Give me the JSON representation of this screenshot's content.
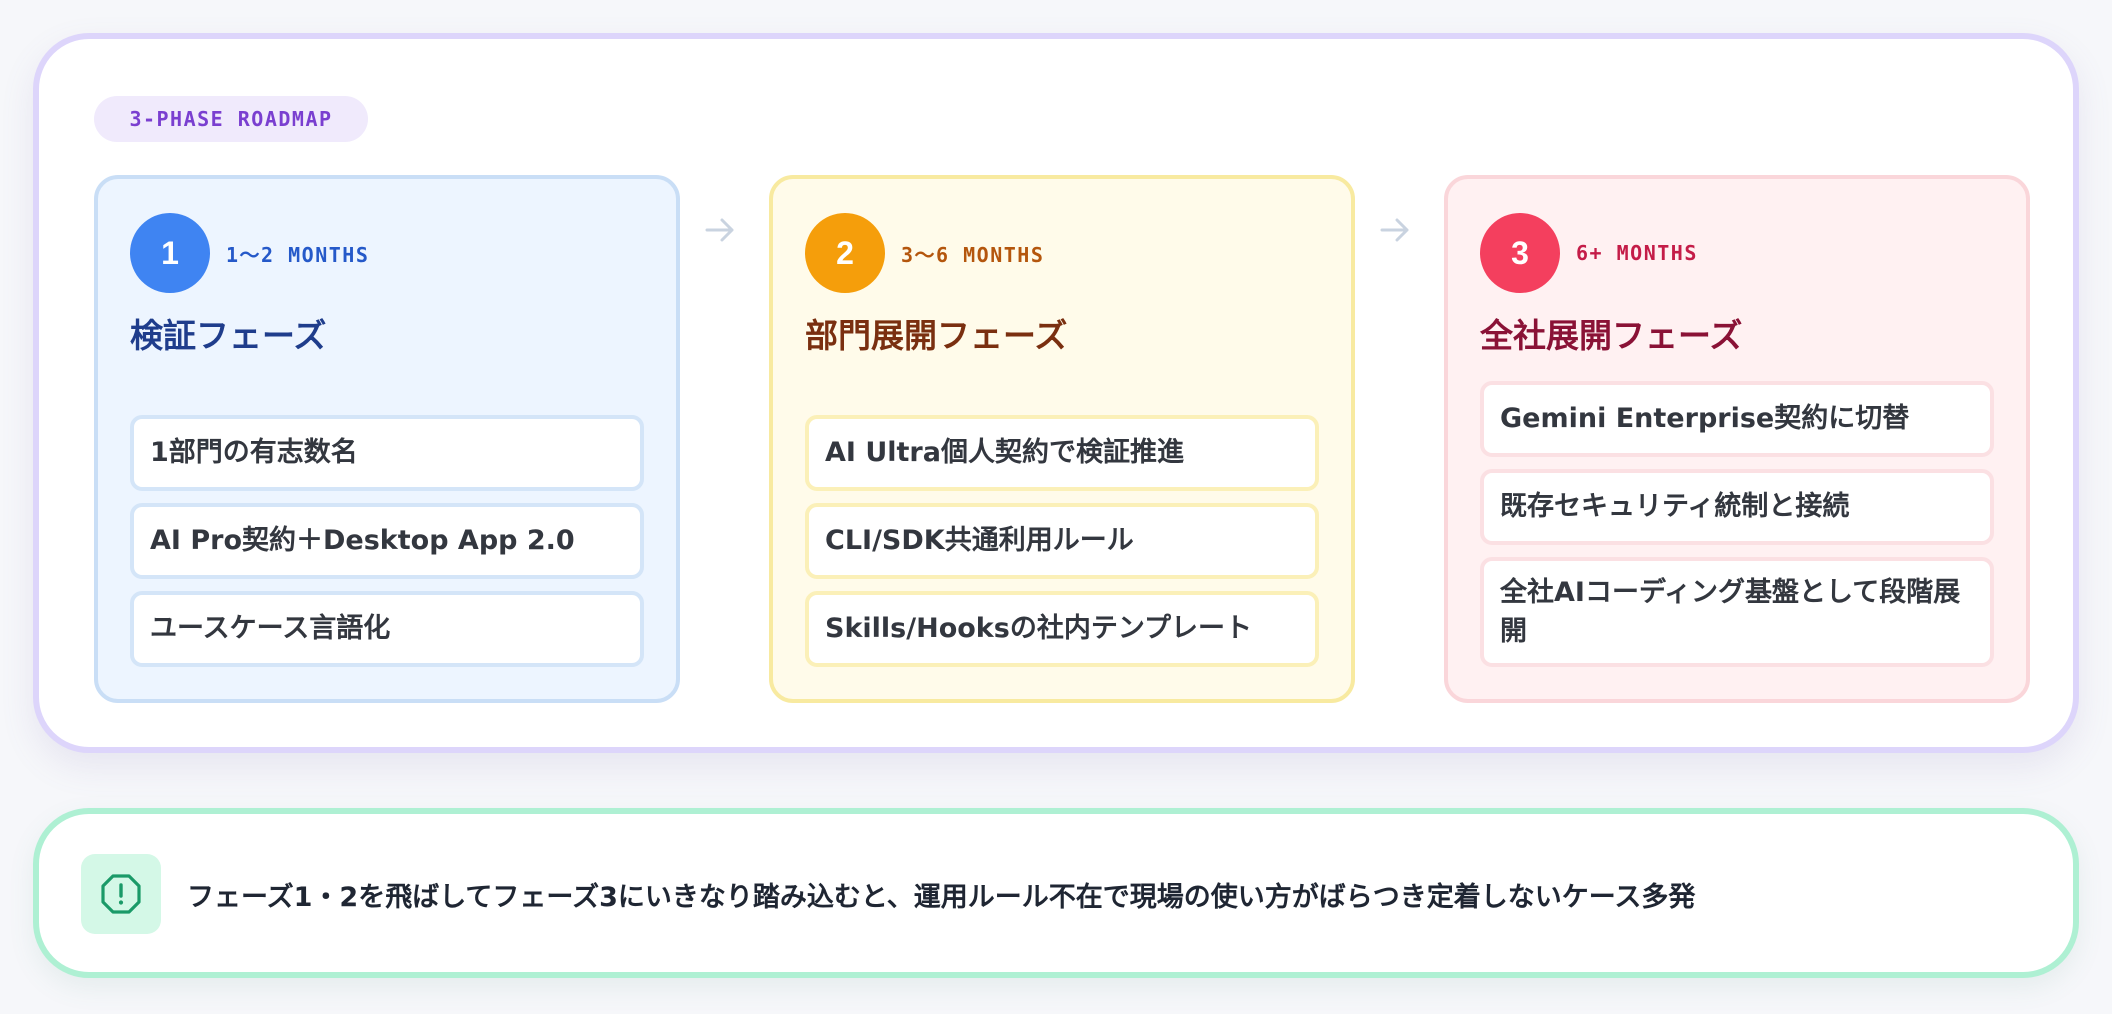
{
  "badge": "3-PHASE ROADMAP",
  "phases": [
    {
      "number": "1",
      "duration": "1〜2 MONTHS",
      "title": "検証フェーズ",
      "items": [
        "1部門の有志数名",
        "AI Pro契約＋Desktop App 2.0",
        "ユースケース言語化"
      ]
    },
    {
      "number": "2",
      "duration": "3〜6 MONTHS",
      "title": "部門展開フェーズ",
      "items": [
        "AI Ultra個人契約で検証推進",
        "CLI/SDK共通利用ルール",
        "Skills/Hooksの社内テンプレート"
      ]
    },
    {
      "number": "3",
      "duration": "6+ MONTHS",
      "title": "全社展開フェーズ",
      "items": [
        "Gemini Enterprise契約に切替",
        "既存セキュリティ統制と接続",
        "全社AIコーディング基盤として段階展開"
      ]
    }
  ],
  "warning": {
    "icon": "alert-circle-icon",
    "text": "フェーズ1・2を飛ばしてフェーズ3にいきなり踏み込むと、運用ルール不在で現場の使い方がばらつき定着しないケース多発"
  },
  "colors": {
    "phase1_accent": "#3f84f2",
    "phase2_accent": "#f59e0b",
    "phase3_accent": "#f43f5e",
    "roadmap_border": "#ddd5fb",
    "warning_border": "#aef0d3",
    "warning_icon": "#1a9a68"
  }
}
